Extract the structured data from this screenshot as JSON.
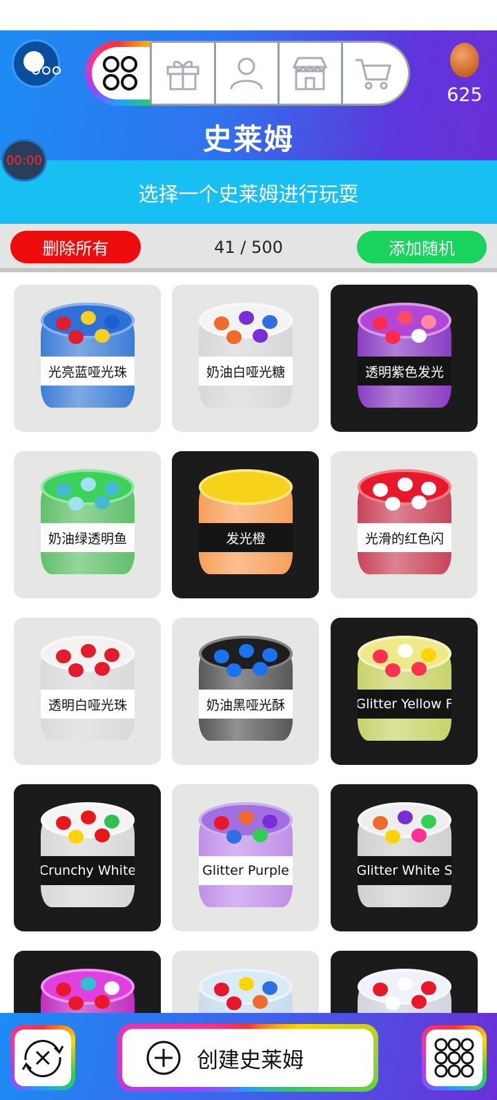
{
  "header": {
    "title": "史莱姆",
    "coin_count": "625",
    "timer": "00:00",
    "nav_tabs": [
      {
        "icon": "grid-four-icon",
        "active": true
      },
      {
        "icon": "gift-icon",
        "active": false
      },
      {
        "icon": "user-icon",
        "active": false
      },
      {
        "icon": "shop-icon",
        "active": false
      },
      {
        "icon": "cart-icon",
        "active": false
      }
    ]
  },
  "subtitle": "选择一个史莱姆进行玩耍",
  "actions": {
    "delete_all": "删除所有",
    "count": "41 / 500",
    "add_random": "添加随机"
  },
  "slimes": [
    {
      "label": "光亮蓝哑光珠",
      "theme": "light",
      "top": "#2f6fd8",
      "body": "#3d7dd6",
      "accents": [
        "#e41b2b",
        "#f4d020",
        "#1c5fd0",
        "#e41b2b",
        "#f4d020"
      ]
    },
    {
      "label": "奶油白哑光糖",
      "theme": "light",
      "top": "#f3f3f3",
      "body": "#d7d7d9",
      "accents": [
        "#f06a2c",
        "#7a2fd6",
        "#2f6fe0",
        "#f06a2c",
        "#7a2fd6"
      ]
    },
    {
      "label": "透明紫色发光",
      "theme": "dark",
      "top": "#b246d8",
      "body": "#8a3ec2",
      "accents": [
        "#ff2b4a",
        "#ff4a6a",
        "#ff8aa0",
        "#ff2b4a",
        "#ffffff"
      ]
    },
    {
      "label": "奶油绿透明鱼",
      "theme": "light",
      "top": "#3cd25a",
      "body": "#5fc06b",
      "accents": [
        "#46b8d4",
        "#9fe3f0",
        "#46b8d4",
        "#9fe3f0",
        "#46b8d4"
      ]
    },
    {
      "label": "发光橙",
      "theme": "dark",
      "top": "#f7d21a",
      "body": "#f7a05a",
      "accents": []
    },
    {
      "label": "光滑的红色闪",
      "theme": "light",
      "top": "#e8182a",
      "body": "#c9445a",
      "accents": [
        "#ffffff",
        "#ffffff",
        "#ffffff",
        "#ffffff",
        "#ffffff"
      ]
    },
    {
      "label": "透明白哑光珠",
      "theme": "light",
      "top": "#f2f2f2",
      "body": "#d9d9db",
      "accents": [
        "#e41b2b",
        "#e41b2b",
        "#e41b2b",
        "#e41b2b",
        "#e41b2b"
      ]
    },
    {
      "label": "奶油黑哑光酥",
      "theme": "light",
      "top": "#1e1e1e",
      "body": "#585858",
      "accents": [
        "#1a73f0",
        "#1a73f0",
        "#1a73f0",
        "#1a73f0",
        "#1a73f0"
      ]
    },
    {
      "label": "Glitter Yellow F",
      "theme": "dark",
      "top": "#f0e98a",
      "body": "#c8d36a",
      "accents": [
        "#ff3050",
        "#ffffff",
        "#ffd400",
        "#ff3050",
        "#ff3050"
      ]
    },
    {
      "label": "Crunchy White",
      "theme": "dark",
      "top": "#f4f4f4",
      "body": "#d8d8d8",
      "accents": [
        "#e81818",
        "#e81818",
        "#30c050",
        "#ffd400",
        "#e81818"
      ]
    },
    {
      "label": "Glitter Purple",
      "theme": "light",
      "top": "#a070e0",
      "body": "#c090e8",
      "accents": [
        "#e8182a",
        "#f06a2c",
        "#7a2fd6",
        "#2f6fe0",
        "#30d050"
      ]
    },
    {
      "label": "Glitter White S",
      "theme": "dark",
      "top": "#eeeeee",
      "body": "#d0d0d0",
      "accents": [
        "#f06a2c",
        "#7a2fd6",
        "#30d050",
        "#ffd400",
        "#ff3090"
      ]
    },
    {
      "label": "",
      "theme": "dark",
      "top": "#e040e0",
      "body": "#c030c0",
      "accents": [
        "#e8182a",
        "#30c0d0",
        "#ffffff",
        "#e8182a",
        "#e8182a"
      ]
    },
    {
      "label": "",
      "theme": "light",
      "top": "#d8ecf8",
      "body": "#c8dcec",
      "accents": [
        "#e8182a",
        "#ffd400",
        "#2f6fe0",
        "#e8182a",
        "#f06a2c"
      ]
    },
    {
      "label": "",
      "theme": "dark",
      "top": "#eef2fa",
      "body": "#d0d4dc",
      "accents": [
        "#e8182a",
        "#ffffff",
        "#e8182a",
        "#ffffff",
        "#e8182a"
      ]
    }
  ],
  "bottom": {
    "create_label": "创建史莱姆",
    "left_icon": "swap-icon",
    "right_icon": "grid-nine-icon"
  }
}
